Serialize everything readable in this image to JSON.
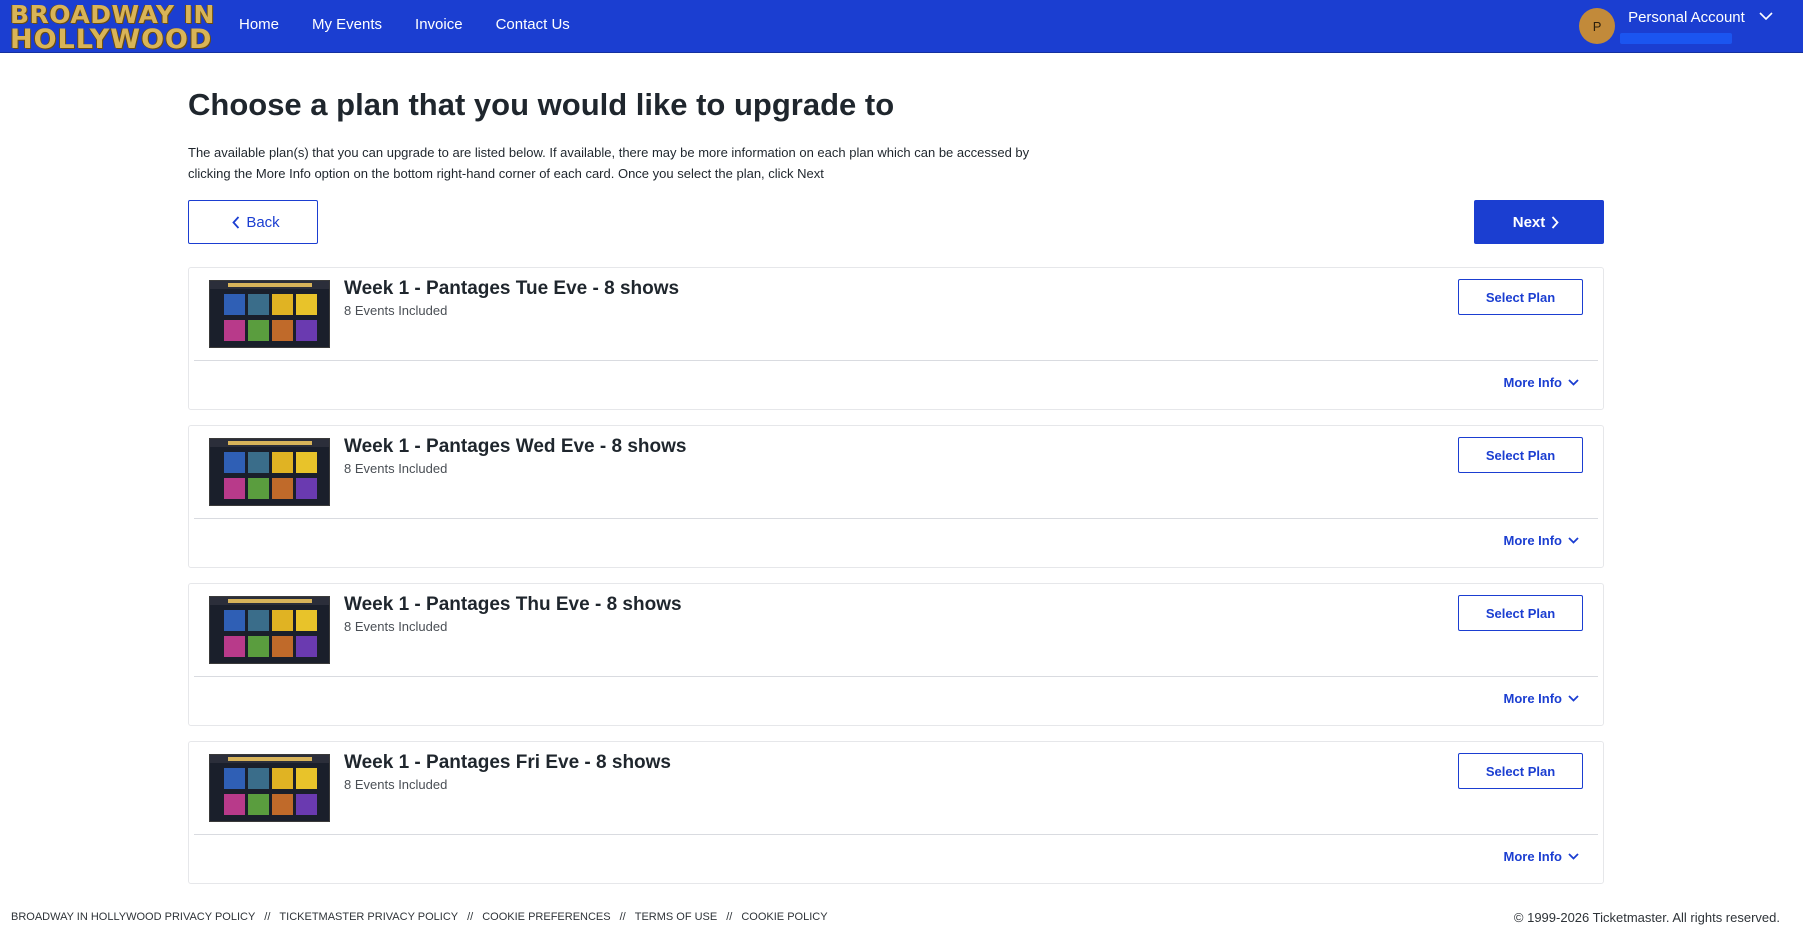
{
  "header": {
    "logo_line1": "BROADWAY IN",
    "logo_line2": "HOLLYWOOD",
    "nav": [
      "Home",
      "My Events",
      "Invoice",
      "Contact Us"
    ],
    "account": {
      "avatar_letter": "P",
      "name": "Personal Account"
    }
  },
  "main": {
    "title": "Choose a plan that you would like to upgrade to",
    "description": "The available plan(s) that you can upgrade to are listed below. If available, there may be more information on each plan which can be accessed by clicking the More Info option on the bottom right-hand corner of each card. Once you select the plan, click Next",
    "back_label": "Back",
    "next_label": "Next",
    "plans": [
      {
        "title": "Week 1 - Pantages Tue Eve - 8 shows",
        "subtitle": "8 Events Included",
        "select_label": "Select Plan",
        "more_label": "More Info"
      },
      {
        "title": "Week 1 - Pantages Wed Eve - 8 shows",
        "subtitle": "8 Events Included",
        "select_label": "Select Plan",
        "more_label": "More Info"
      },
      {
        "title": "Week 1 - Pantages Thu Eve - 8 shows",
        "subtitle": "8 Events Included",
        "select_label": "Select Plan",
        "more_label": "More Info"
      },
      {
        "title": "Week 1 - Pantages Fri Eve - 8 shows",
        "subtitle": "8 Events Included",
        "select_label": "Select Plan",
        "more_label": "More Info"
      }
    ]
  },
  "footer": {
    "links": [
      "BROADWAY IN HOLLYWOOD PRIVACY POLICY",
      "TICKETMASTER PRIVACY POLICY",
      "COOKIE PREFERENCES",
      "TERMS OF USE",
      "COOKIE POLICY"
    ],
    "separator": "//",
    "copyright": "© 1999-2026 Ticketmaster. All rights reserved."
  },
  "colors": {
    "brand_blue": "#1b3ed1",
    "logo_gold": "#d9b457",
    "avatar": "#c28a3a"
  },
  "icons": [
    "chevron-left-icon",
    "chevron-right-icon",
    "chevron-down-icon"
  ]
}
